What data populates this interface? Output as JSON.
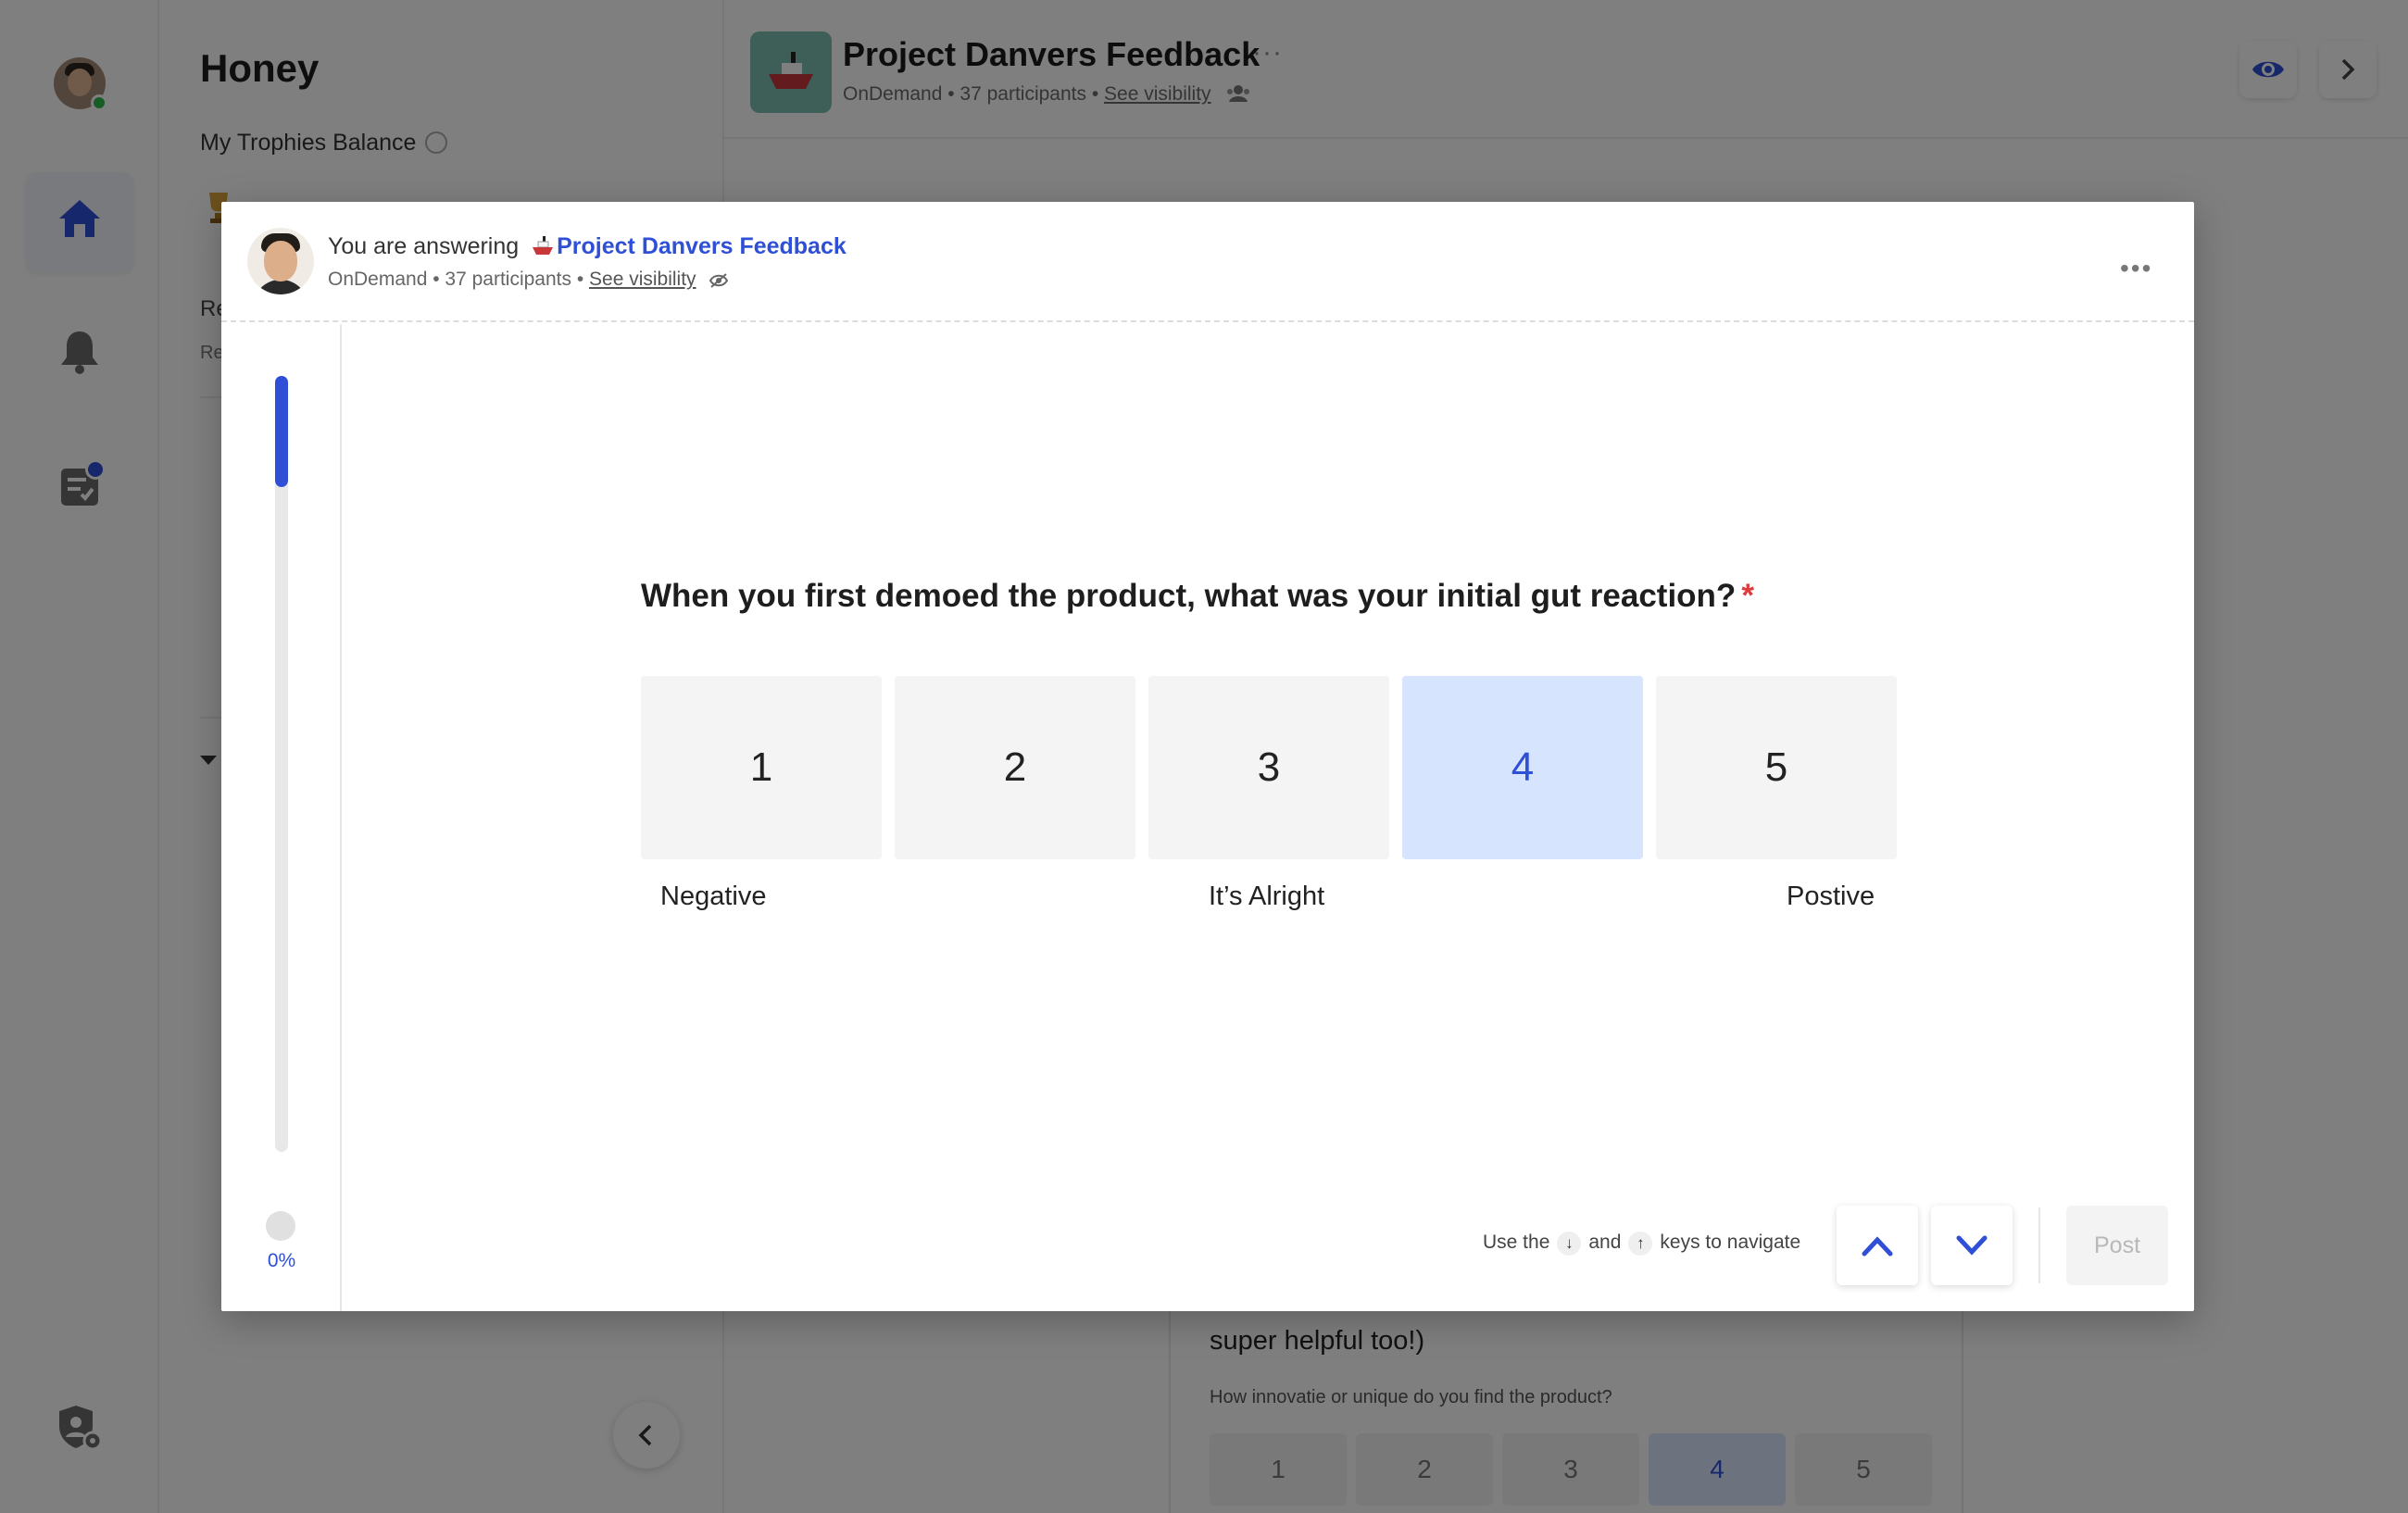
{
  "sidebar": {
    "items": [
      "home-icon",
      "bell-icon",
      "tasks-icon",
      "admin-shield-icon"
    ],
    "accent": "#2e4fd6",
    "online_color": "#2fb84c"
  },
  "left_panel": {
    "title": "Honey",
    "trophies_label": "My Trophies Balance",
    "truncated_row_1": "Re",
    "truncated_row_2": "Re"
  },
  "topbar": {
    "title": "Project Danvers Feedback",
    "more": "···",
    "meta": "OnDemand • 37 participants • ",
    "visibility_link": "See visibility"
  },
  "background_card": {
    "text": "super helpful too!)",
    "question": "How innovatie or unique do you find the product?",
    "options": [
      "1",
      "2",
      "3",
      "4",
      "5"
    ],
    "selected": "4"
  },
  "modal": {
    "answering_prefix": "You are answering",
    "project_name": "Project Danvers Feedback",
    "meta": "OnDemand • 37 participants • ",
    "visibility_link": "See visibility",
    "more": "•••",
    "progress_percent_label": "0%",
    "progress_fraction": 0.0,
    "question": "When you first demoed the product, what was your initial gut reaction?",
    "required_mark": "*",
    "scale": {
      "options": [
        "1",
        "2",
        "3",
        "4",
        "5"
      ],
      "selected": "4",
      "low_label": "Negative",
      "mid_label": "It’s Alright",
      "high_label": "Postive"
    },
    "nav": {
      "hint_prefix": "Use the",
      "down_key": "↓",
      "and": "and",
      "up_key": "↑",
      "hint_suffix": "keys to navigate",
      "post_label": "Post"
    }
  },
  "colors": {
    "accent_blue": "#2e4fd6",
    "selected_bg": "#d6e4fd",
    "required_red": "#e03a3a",
    "overlay": "rgba(0,0,0,0.5)"
  }
}
